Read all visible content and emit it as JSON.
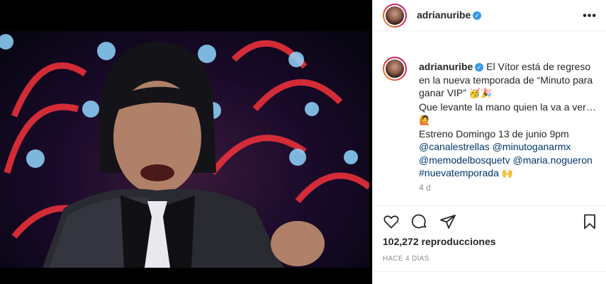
{
  "post": {
    "username": "adrianuribe",
    "caption": {
      "line1": "El Vítor está de regreso en la nueva temporada de “Minuto para ganar VIP”",
      "line2": "Que levante la mano quien la va a ver…",
      "line3": "Estreno Domingo 13 de junio 9pm",
      "mentions": [
        "@canalestrellas",
        "@minutoganarmx",
        "@memodelbosquetv",
        "@maria.nogueron"
      ],
      "hashtag": "#nuevatemporada"
    },
    "time_ago": "4 d",
    "views_label": "102,272 reproducciones",
    "date_label": "HACE 4 DÍAS"
  },
  "icons": {
    "like": "heart-icon",
    "comment": "comment-icon",
    "share": "paper-plane-icon",
    "save": "bookmark-icon",
    "mute": "speaker-icon",
    "more": "more-options-icon"
  },
  "colors": {
    "verified": "#3897f0",
    "mention": "#00376b",
    "muted_text": "#8e8e8e"
  }
}
